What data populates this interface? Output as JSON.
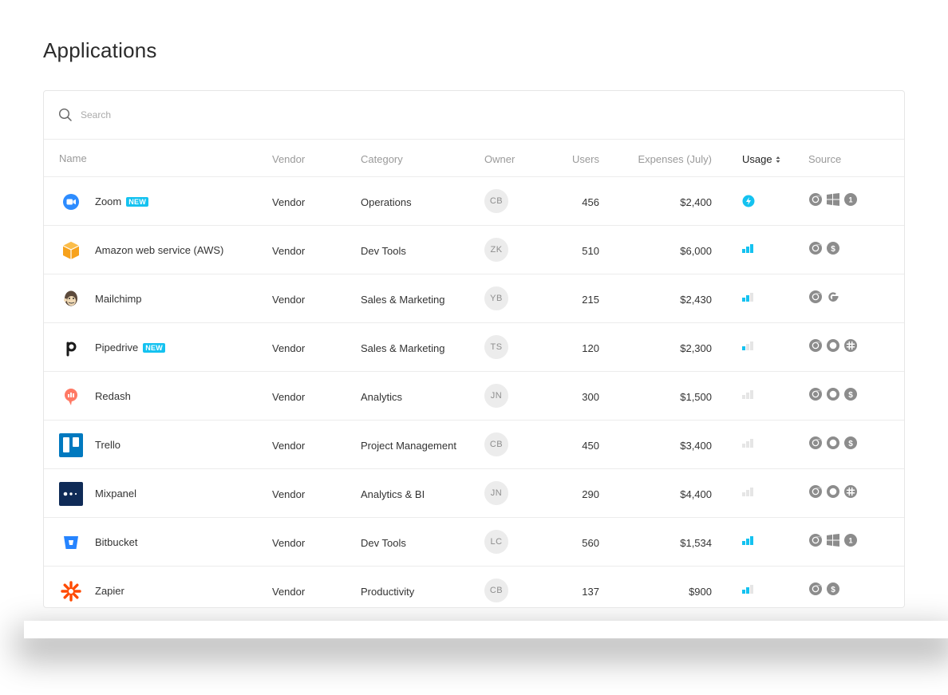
{
  "page": {
    "title": "Applications"
  },
  "search": {
    "placeholder": "Search"
  },
  "columns": {
    "name": "Name",
    "vendor": "Vendor",
    "category": "Category",
    "owner": "Owner",
    "users": "Users",
    "expenses": "Expenses (July)",
    "usage": "Usage",
    "source": "Source"
  },
  "badge_text": "NEW",
  "colors": {
    "accent": "#14c2f0",
    "usage_inactive": "#e5e5e5",
    "source_icon": "#8c8c8c"
  },
  "rows": [
    {
      "name": "Zoom",
      "badge": true,
      "logo": "zoom-logo",
      "vendor": "Vendor",
      "category": "Operations",
      "owner": "CB",
      "users": "456",
      "expenses": "$2,400",
      "usage": "lightning-icon",
      "sources": [
        "chrome-icon",
        "windows-icon",
        "one-icon"
      ]
    },
    {
      "name": "Amazon web service (AWS)",
      "badge": false,
      "logo": "aws-logo",
      "vendor": "Vendor",
      "category": "Dev Tools",
      "owner": "ZK",
      "users": "510",
      "expenses": "$6,000",
      "usage": 3,
      "sources": [
        "chrome-icon",
        "dollar-icon"
      ]
    },
    {
      "name": "Mailchimp",
      "badge": false,
      "logo": "mailchimp-logo",
      "vendor": "Vendor",
      "category": "Sales & Marketing",
      "owner": "YB",
      "users": "215",
      "expenses": "$2,430",
      "usage": 2,
      "sources": [
        "chrome-icon",
        "google-icon"
      ]
    },
    {
      "name": "Pipedrive",
      "badge": true,
      "logo": "pipedrive-logo",
      "vendor": "Vendor",
      "category": "Sales & Marketing",
      "owner": "TS",
      "users": "120",
      "expenses": "$2,300",
      "usage": 1,
      "sources": [
        "chrome-icon",
        "circle-icon",
        "slack-icon"
      ]
    },
    {
      "name": "Redash",
      "badge": false,
      "logo": "redash-logo",
      "vendor": "Vendor",
      "category": "Analytics",
      "owner": "JN",
      "users": "300",
      "expenses": "$1,500",
      "usage": 0,
      "sources": [
        "chrome-icon",
        "circle-icon",
        "dollar-icon"
      ]
    },
    {
      "name": "Trello",
      "badge": false,
      "logo": "trello-logo",
      "vendor": "Vendor",
      "category": "Project Management",
      "owner": "CB",
      "users": "450",
      "expenses": "$3,400",
      "usage": 0,
      "sources": [
        "chrome-icon",
        "circle-icon",
        "dollar-icon"
      ]
    },
    {
      "name": "Mixpanel",
      "badge": false,
      "logo": "mixpanel-logo",
      "vendor": "Vendor",
      "category": "Analytics & BI",
      "owner": "JN",
      "users": "290",
      "expenses": "$4,400",
      "usage": 0,
      "sources": [
        "chrome-icon",
        "circle-icon",
        "slack-icon"
      ]
    },
    {
      "name": "Bitbucket",
      "badge": false,
      "logo": "bitbucket-logo",
      "vendor": "Vendor",
      "category": "Dev Tools",
      "owner": "LC",
      "users": "560",
      "expenses": "$1,534",
      "usage": 3,
      "sources": [
        "chrome-icon",
        "windows-icon",
        "one-icon"
      ]
    },
    {
      "name": "Zapier",
      "badge": false,
      "logo": "zapier-logo",
      "vendor": "Vendor",
      "category": "Productivity",
      "owner": "CB",
      "users": "137",
      "expenses": "$900",
      "usage": 2,
      "sources": [
        "chrome-icon",
        "dollar-icon"
      ]
    }
  ]
}
